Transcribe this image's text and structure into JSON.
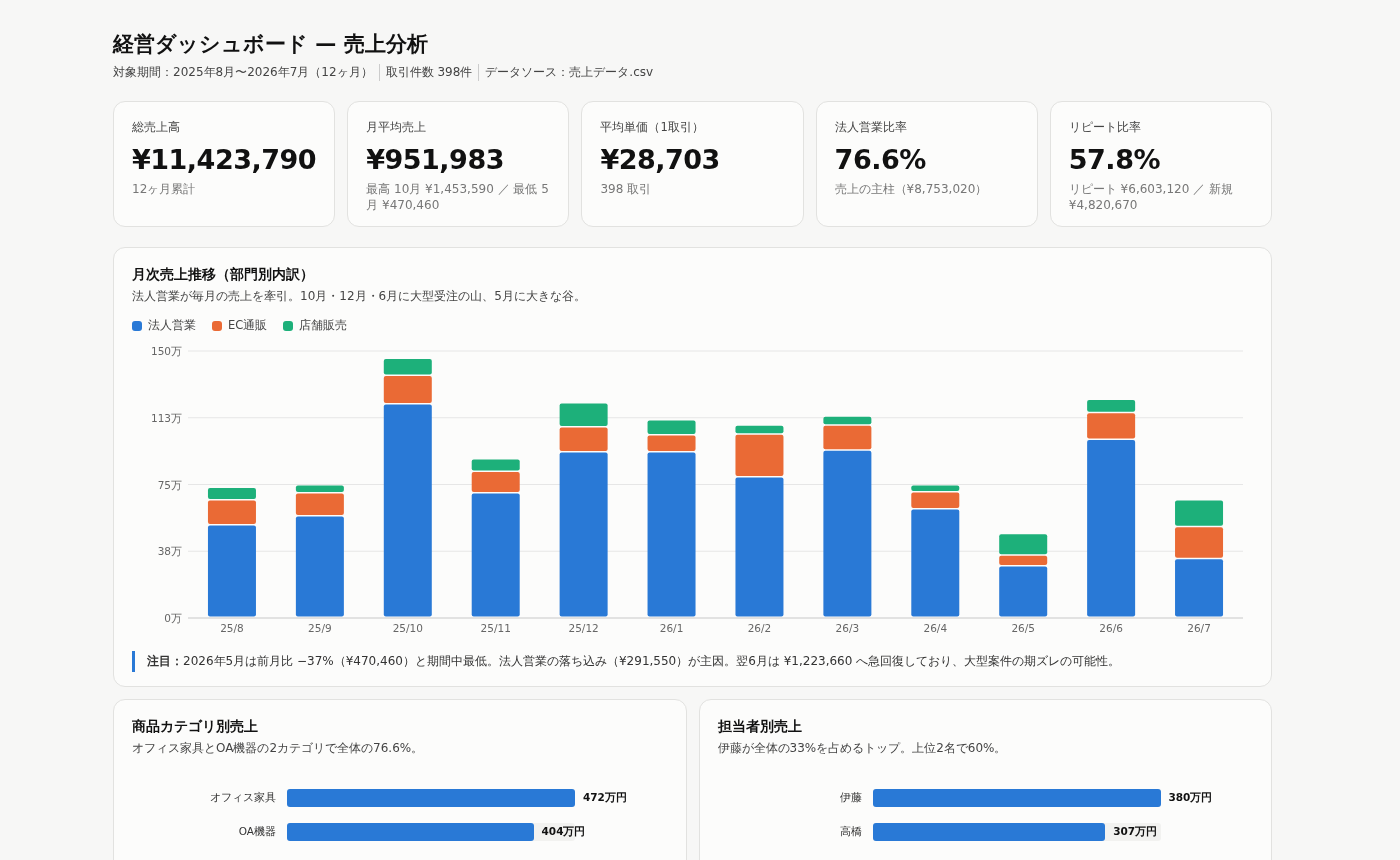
{
  "header": {
    "title": "経営ダッシュボード — 売上分析",
    "meta": [
      "対象期間：2025年8月〜2026年7月（12ヶ月）",
      "取引件数 398件",
      "データソース：売上データ.csv"
    ]
  },
  "kpis": [
    {
      "label": "総売上高",
      "value": "¥11,423,790",
      "note": "12ヶ月累計"
    },
    {
      "label": "月平均売上",
      "value": "¥951,983",
      "note": "最高 10月 ¥1,453,590 ／ 最低 5月 ¥470,460"
    },
    {
      "label": "平均単価（1取引）",
      "value": "¥28,703",
      "note": "398 取引"
    },
    {
      "label": "法人営業比率",
      "value": "76.6%",
      "note": "売上の主柱（¥8,753,020）"
    },
    {
      "label": "リピート比率",
      "value": "57.8%",
      "note": "リピート ¥6,603,120 ／ 新規 ¥4,820,670"
    }
  ],
  "monthly": {
    "title": "月次売上推移（部門別内訳）",
    "subtitle": "法人営業が毎月の売上を牽引。10月・12月・6月に大型受注の山、5月に大きな谷。",
    "chart_data": {
      "type": "bar",
      "stacked": true,
      "categories": [
        "25/8",
        "25/9",
        "25/10",
        "25/11",
        "25/12",
        "26/1",
        "26/2",
        "26/3",
        "26/4",
        "26/5",
        "26/6",
        "26/7"
      ],
      "series": [
        {
          "name": "法人営業",
          "color": "#2979d6",
          "values": [
            52,
            57,
            120,
            70,
            93,
            93,
            79,
            94,
            61,
            29,
            100,
            33
          ]
        },
        {
          "name": "EC通販",
          "color": "#ea6a35",
          "values": [
            14,
            13,
            16,
            12,
            14,
            9.5,
            24,
            14,
            9.5,
            6,
            15,
            18
          ]
        },
        {
          "name": "店舗販売",
          "color": "#1db07a",
          "values": [
            7,
            4.5,
            9.5,
            7,
            13.5,
            8.5,
            5,
            5,
            4,
            12,
            7.5,
            15
          ]
        }
      ],
      "grid": true,
      "ylim": [
        0,
        150
      ],
      "yticks": [
        {
          "value": 0,
          "label": "0万"
        },
        {
          "value": 37.5,
          "label": "38万"
        },
        {
          "value": 75,
          "label": "75万"
        },
        {
          "value": 112.5,
          "label": "113万"
        },
        {
          "value": 150,
          "label": "150万"
        }
      ]
    },
    "note": "**注目：**2026年5月は前月比 −37%（¥470,460）と期間中最低。法人営業の落ち込み（¥291,550）が主因。翌6月は ¥1,223,660 へ急回復しており、大型案件の期ズレの可能性。"
  },
  "panels": [
    {
      "title": "商品カテゴリ別売上",
      "subtitle": "オフィス家具とOA機器の2カテゴリで全体の76.6%。",
      "bars": [
        {
          "label": "オフィス家具",
          "value": "472万円",
          "level": 1
        },
        {
          "label": "OA機器",
          "value": "404万円",
          "level": 0.856
        }
      ]
    },
    {
      "title": "担当者別売上",
      "subtitle": "伊藤が全体の33%を占めるトップ。上位2名で60%。",
      "bars": [
        {
          "label": "伊藤",
          "value": "380万円",
          "level": 1
        },
        {
          "label": "高橋",
          "value": "307万円",
          "level": 0.808
        }
      ]
    }
  ]
}
